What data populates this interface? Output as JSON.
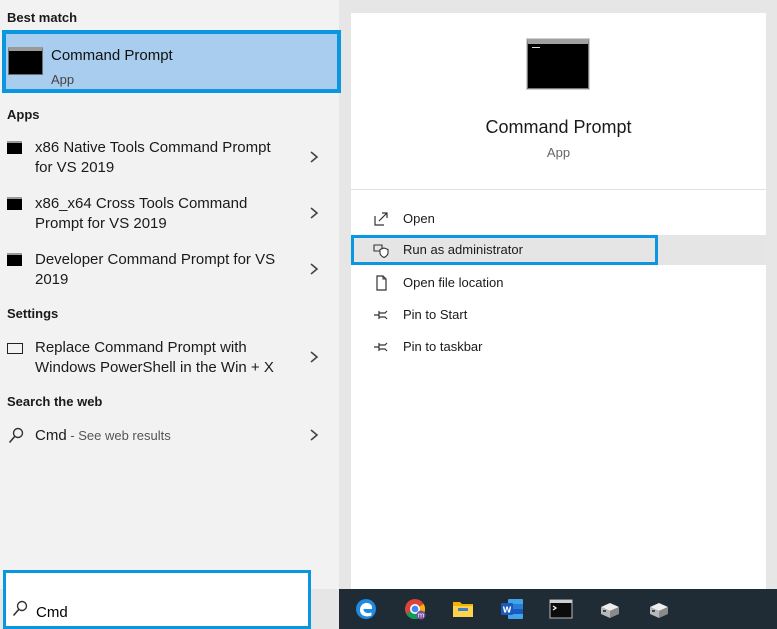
{
  "left": {
    "best_match_heading": "Best match",
    "best_match": {
      "title": "Command Prompt",
      "subtitle": "App"
    },
    "apps_heading": "Apps",
    "apps": [
      {
        "line1": "x86 Native Tools Command Prompt",
        "line2": "for VS 2019"
      },
      {
        "line1": "x86_x64 Cross Tools Command",
        "line2": "Prompt for VS 2019"
      },
      {
        "line1": "Developer Command Prompt for VS",
        "line2": "2019"
      }
    ],
    "settings_heading": "Settings",
    "settings": [
      {
        "line1": "Replace Command Prompt with",
        "line2": "Windows PowerShell in the Win + X"
      }
    ],
    "web_heading": "Search the web",
    "web": {
      "query": "Cmd",
      "suffix": " - See web results"
    }
  },
  "right": {
    "title": "Command Prompt",
    "subtitle": "App",
    "actions": [
      {
        "label": "Open",
        "icon": "open-icon"
      },
      {
        "label": "Run as administrator",
        "icon": "shield-icon"
      },
      {
        "label": "Open file location",
        "icon": "file-location-icon"
      },
      {
        "label": "Pin to Start",
        "icon": "pin-icon"
      },
      {
        "label": "Pin to taskbar",
        "icon": "pin-icon"
      }
    ]
  },
  "search": {
    "value": "Cmd"
  },
  "taskbar": {
    "apps": [
      "edge-icon",
      "chrome-icon",
      "file-explorer-icon",
      "word-icon",
      "terminal-icon",
      "app-icon",
      "app-icon"
    ]
  },
  "colors": {
    "accent": "#0a96e0",
    "selected": "#a8cdee",
    "taskbar": "#1f2b35"
  }
}
